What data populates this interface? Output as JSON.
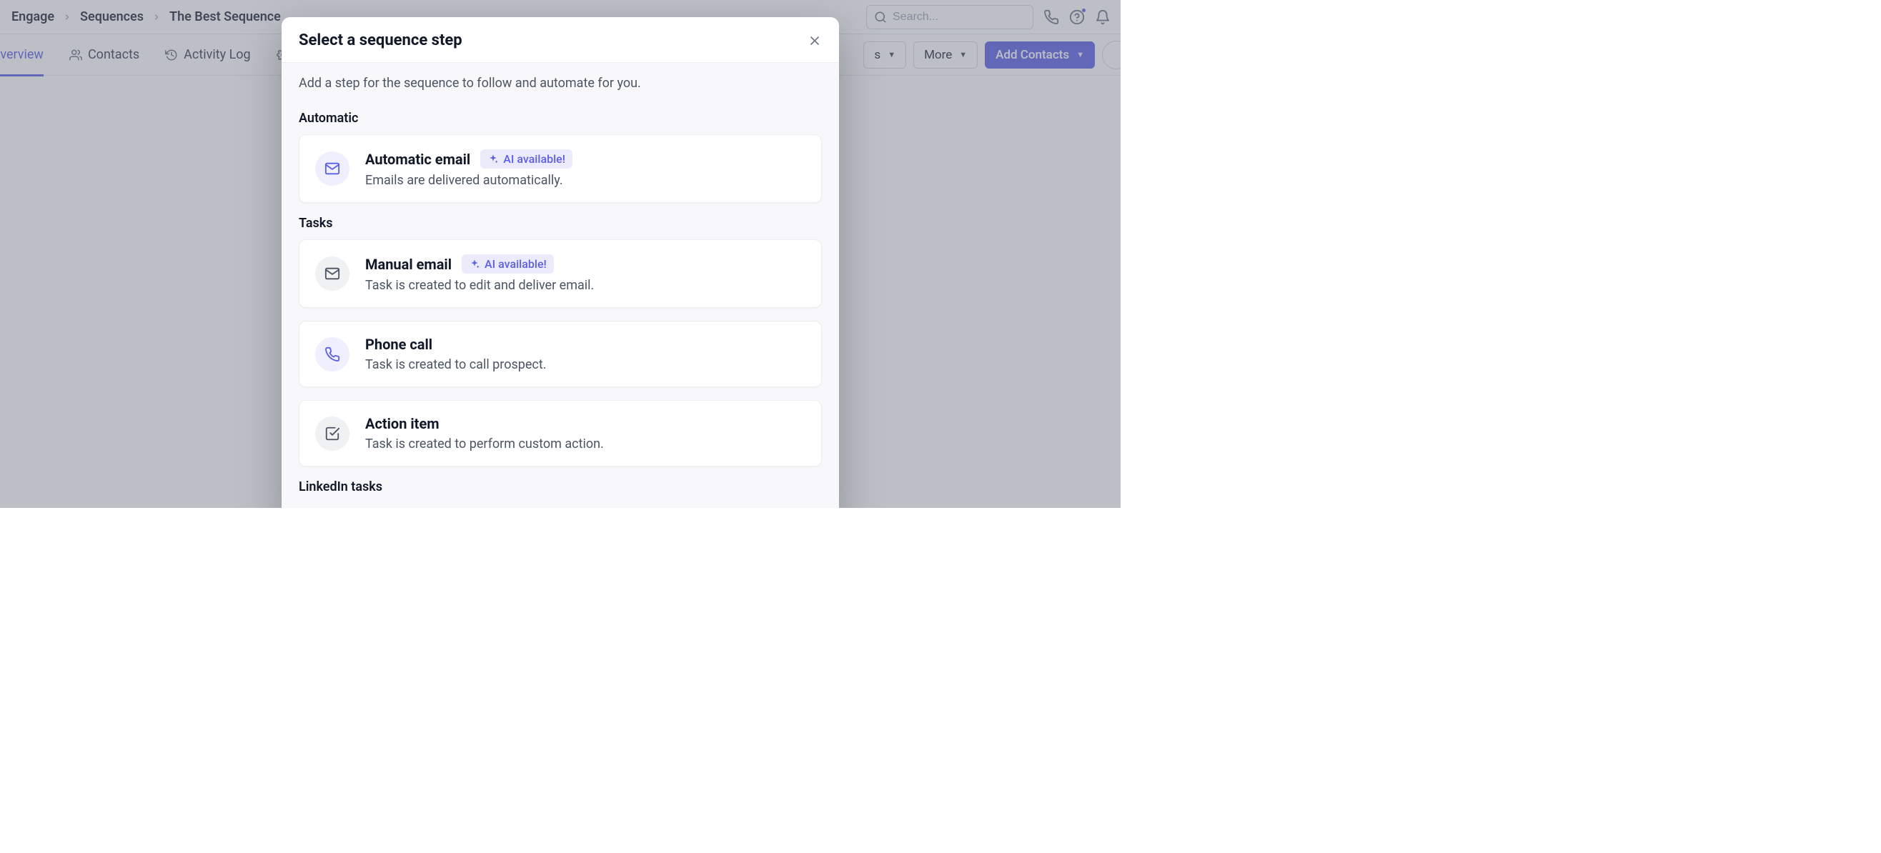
{
  "breadcrumb": [
    "Engage",
    "Sequences",
    "The Best Sequence"
  ],
  "search": {
    "placeholder": "Search..."
  },
  "tabs": {
    "overview": "Overview",
    "contacts": "Contacts",
    "activity_log": "Activity Log",
    "settings_fragment": "S"
  },
  "actions": {
    "partial_dropdown": "s",
    "more": "More",
    "add_contacts": "Add Contacts"
  },
  "modal": {
    "title": "Select a sequence step",
    "subtitle": "Add a step for the sequence to follow and automate for you.",
    "sections": {
      "automatic": {
        "label": "Automatic",
        "items": [
          {
            "title": "Automatic email",
            "desc": "Emails are delivered automatically.",
            "ai_badge": "AI available!"
          }
        ]
      },
      "tasks": {
        "label": "Tasks",
        "items": [
          {
            "title": "Manual email",
            "desc": "Task is created to edit and deliver email.",
            "ai_badge": "AI available!"
          },
          {
            "title": "Phone call",
            "desc": "Task is created to call prospect."
          },
          {
            "title": "Action item",
            "desc": "Task is created to perform custom action."
          }
        ]
      },
      "linkedin": {
        "label": "LinkedIn tasks"
      }
    }
  }
}
